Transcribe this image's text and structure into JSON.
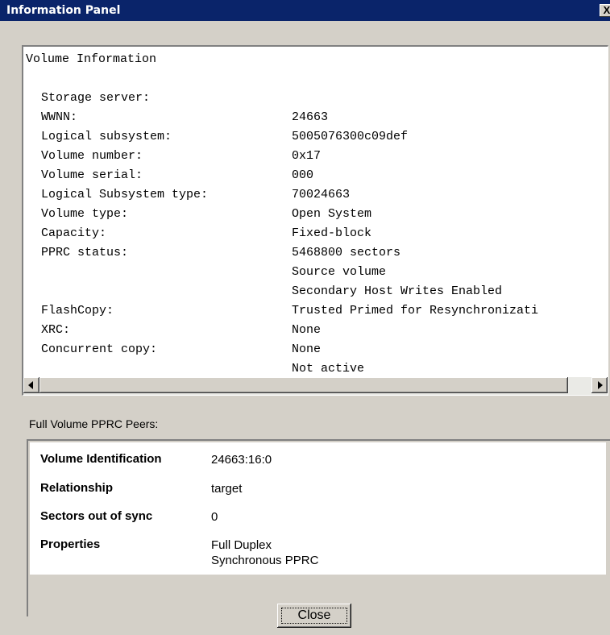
{
  "window": {
    "title": "Information Panel",
    "close_glyph": "X"
  },
  "volume_info": {
    "header": "Volume Information",
    "rows": [
      {
        "label": "Storage server:",
        "value": "24663"
      },
      {
        "label": "WWNN:",
        "value": "5005076300c09def"
      },
      {
        "label": "Logical subsystem:",
        "value": "0x17"
      },
      {
        "label": "Volume number:",
        "value": "000"
      },
      {
        "label": "Volume serial:",
        "value": "70024663"
      },
      {
        "label": "Logical Subsystem type:",
        "value": "Open System"
      },
      {
        "label": "Volume type:",
        "value": "Fixed-block"
      },
      {
        "label": "Capacity:",
        "value": "5468800 sectors"
      },
      {
        "label": "PPRC status:",
        "value": "Source volume"
      },
      {
        "label": "",
        "value": "Secondary Host Writes Enabled"
      },
      {
        "label": "",
        "value": "Trusted Primed for Resynchronizati"
      },
      {
        "label": "FlashCopy:",
        "value": "None"
      },
      {
        "label": "XRC:",
        "value": "None"
      },
      {
        "label": "Concurrent copy:",
        "value": "Not active"
      }
    ]
  },
  "peers": {
    "label": "Full Volume PPRC Peers:",
    "rows": [
      {
        "key": "Volume Identification",
        "value": "24663:16:0"
      },
      {
        "key": "Relationship",
        "value": "target"
      },
      {
        "key": "Sectors out of sync",
        "value": "0"
      },
      {
        "key": "Properties",
        "value": "Full Duplex",
        "value2": "Synchronous PPRC"
      }
    ]
  },
  "buttons": {
    "close_label": "Close"
  }
}
